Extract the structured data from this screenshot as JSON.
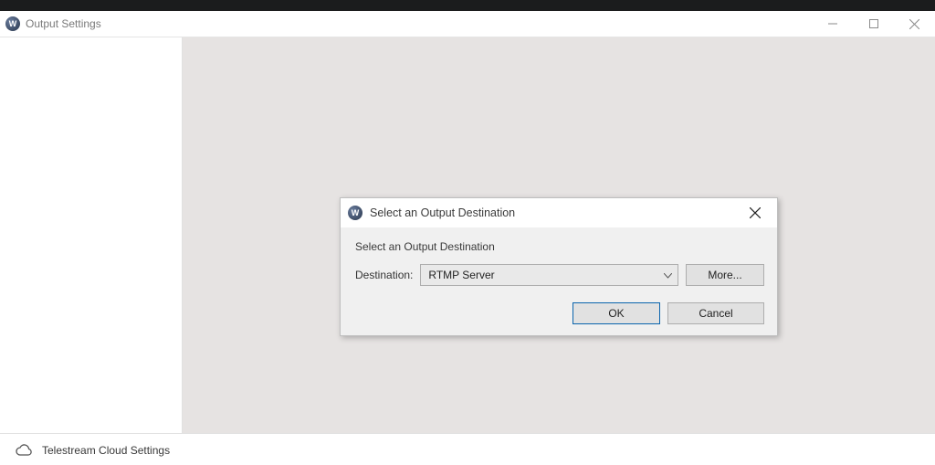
{
  "window": {
    "title": "Output Settings"
  },
  "dialog": {
    "title": "Select an Output Destination",
    "instruction": "Select an Output Destination",
    "destination_label": "Destination:",
    "selected": "RTMP Server",
    "more_label": "More...",
    "ok_label": "OK",
    "cancel_label": "Cancel"
  },
  "footer": {
    "cloud_label": "Telestream Cloud Settings"
  }
}
